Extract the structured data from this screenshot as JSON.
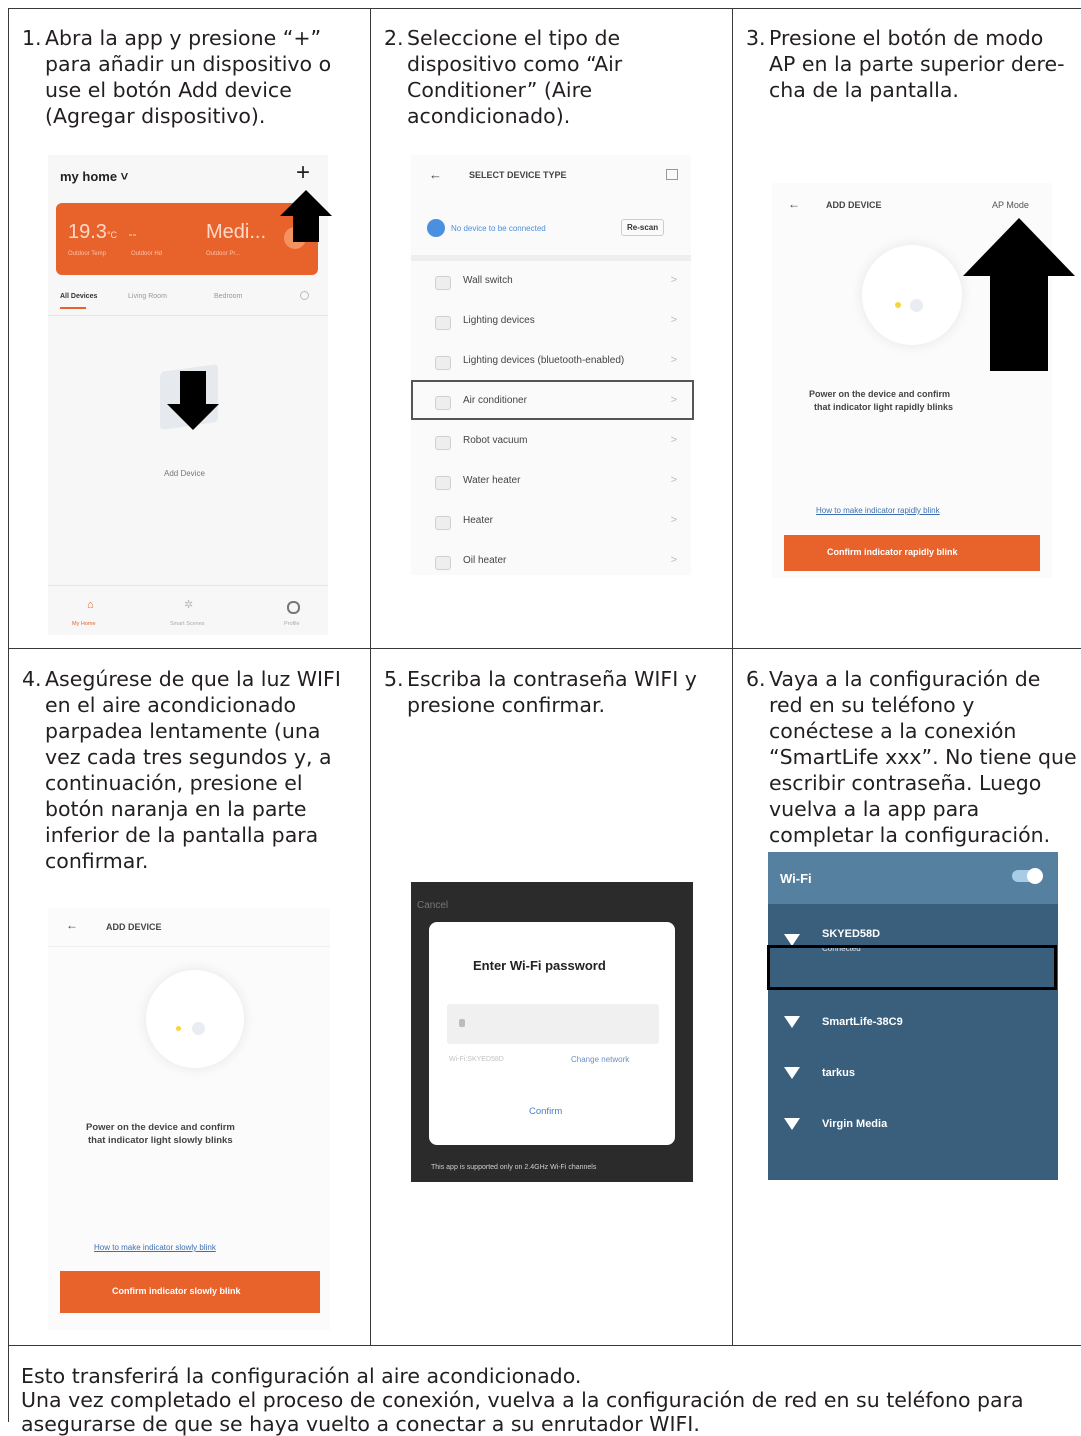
{
  "steps": [
    {
      "num": "1.",
      "text": "Abra la app y presione “+” para añadir un dispositivo o use el botón Add device (Agregar dispositivo)."
    },
    {
      "num": "2.",
      "text": "Seleccione el tipo de dispositivo como “Air Conditioner” (Aire acondicionado)."
    },
    {
      "num": "3.",
      "text": "Presione el botón de modo AP en la parte superior dere-cha de la pantalla."
    },
    {
      "num": "4.",
      "text": "Asegúrese de que la luz WIFI en el aire acondicionado parpadea lentamente (una vez cada tres segundos y, a continuación, presione el botón naranja en la parte inferior de la pantalla para confirmar."
    },
    {
      "num": "5.",
      "text": "Escriba la contraseña WIFI y presione confirmar."
    },
    {
      "num": "6.",
      "text": "Vaya a la configuración de red en su teléfono y conéctese a la conexión “SmartLife xxx”. No tiene que escribir contraseña. Luego vuelva a la app para completar la configuración."
    }
  ],
  "footer": {
    "line1": "Esto transferirá la configuración al aire acondicionado.",
    "line2": "Una vez completado el proceso de conexión, vuelva a la configuración de red en su teléfono para asegurarse de que se haya vuelto a conectar a su enrutador WIFI."
  },
  "screen1": {
    "home_title": "my home ˅",
    "plus": "+",
    "temp": "19.3",
    "temp_unit": "°C",
    "dash": "--",
    "medi": "Medi...",
    "sub_labels": [
      "Outdoor Temp",
      "Outdoor Hd",
      "Outdoor Pr..."
    ],
    "tabs": [
      "All Devices",
      "Living Room",
      "Bedroom"
    ],
    "add_device": "Add Device",
    "nav": [
      "My Home",
      "Smart Scenes",
      "Profile"
    ]
  },
  "screen2": {
    "back": "←",
    "title": "SELECT DEVICE TYPE",
    "scan_text": "No device to be connected",
    "rescan": "Re-scan",
    "items": [
      "Wall switch",
      "Lighting devices",
      "Lighting devices (bluetooth-enabled)",
      "Air conditioner",
      "Robot vacuum",
      "Water heater",
      "Heater",
      "Oil heater"
    ],
    "chevron": ">"
  },
  "screen3": {
    "back": "←",
    "title": "ADD DEVICE",
    "ap_mode": "AP Mode",
    "power_text_1": "Power on the device and confirm",
    "power_text_2": "that indicator light rapidly blinks",
    "link": "How to make indicator rapidly blink",
    "button": "Confirm indicator rapidly blink"
  },
  "screen4": {
    "back": "←",
    "title": "ADD DEVICE",
    "power_text_1": "Power on the device and confirm",
    "power_text_2": "that indicator light slowly blinks",
    "link": "How to make indicator slowly blink",
    "button": "Confirm indicator slowly blink"
  },
  "screen5": {
    "cancel": "Cancel",
    "title": "Enter Wi-Fi password",
    "wifi_name": "Wi-Fi:SKYED58D",
    "change_network": "Change network",
    "confirm": "Confirm",
    "note": "This app is supported only on 2.4GHz Wi-Fi channels"
  },
  "screen6": {
    "title": "Wi-Fi",
    "networks": [
      {
        "name": "SKYED58D",
        "status": "Connected"
      },
      {
        "name": "SmartLife-38C9",
        "status": ""
      },
      {
        "name": "tarkus",
        "status": ""
      },
      {
        "name": "Virgin Media",
        "status": ""
      }
    ]
  },
  "colors": {
    "accent": "#e8622c",
    "wifi_panel": "#3a5f7d",
    "link": "#3e6fb3",
    "dark_panel": "#2b2b2b"
  }
}
